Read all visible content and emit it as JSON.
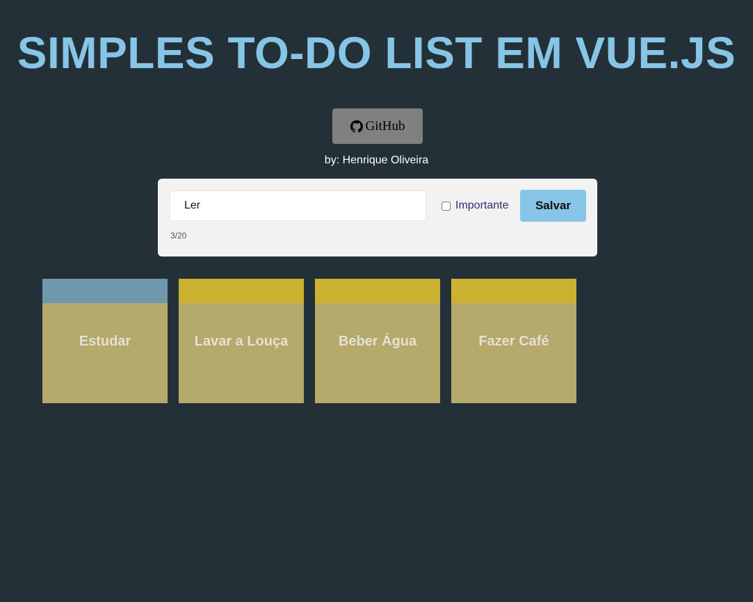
{
  "header": {
    "title": "SIMPLES TO-DO LIST EM VUE.JS",
    "github_label": "GitHub",
    "author": "by: Henrique Oliveira"
  },
  "form": {
    "input_value": "Ler",
    "char_count": "3/20",
    "important_label": "Importante",
    "important_checked": false,
    "save_label": "Salvar"
  },
  "notes": [
    {
      "text": "Estudar",
      "important": false,
      "bar_color": "#6e98ab"
    },
    {
      "text": "Lavar a Louça",
      "important": true,
      "bar_color": "#cdb232"
    },
    {
      "text": "Beber Água",
      "important": true,
      "bar_color": "#cdb232"
    },
    {
      "text": "Fazer Café",
      "important": true,
      "bar_color": "#cdb232"
    }
  ],
  "colors": {
    "background": "#243038",
    "accent": "#87c5e6",
    "note_body": "#b5a96c",
    "normal_bar": "#6e98ab",
    "important_bar": "#cdb232"
  }
}
